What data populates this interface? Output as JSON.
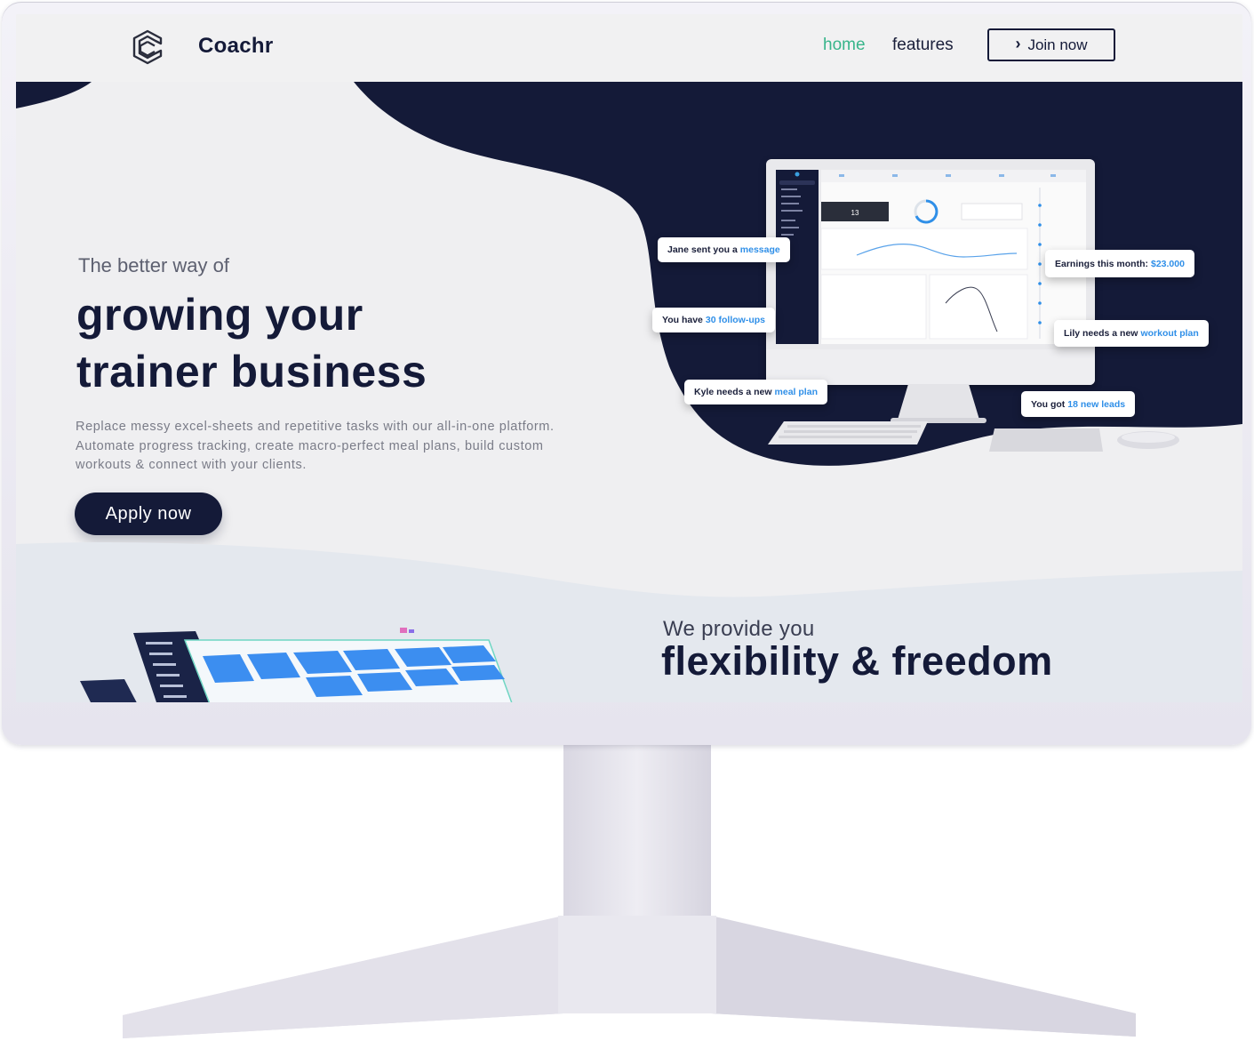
{
  "nav": {
    "brand": "Coachr",
    "links": [
      {
        "label": "home",
        "active": true
      },
      {
        "label": "features",
        "active": false
      }
    ],
    "cta_label": "Join now"
  },
  "hero": {
    "tagline": "The better way of",
    "headline_line1": "growing your",
    "headline_line2": "trainer business",
    "description_line1": "Replace messy excel-sheets and repetitive tasks with our all-in-one platform.",
    "description_line2": "Automate progress tracking, create macro-perfect meal plans, build custom",
    "description_line3": "workouts & connect with your clients.",
    "apply_label": "Apply now"
  },
  "notifications": [
    {
      "prefix": "Jane sent you a",
      "highlight": "message"
    },
    {
      "prefix": "You have",
      "highlight": "30 follow-ups"
    },
    {
      "prefix": "Kyle needs a new",
      "highlight": "meal plan"
    },
    {
      "prefix": "Earnings this month:",
      "highlight": "$23.000"
    },
    {
      "prefix": "Lily needs a new",
      "highlight": "workout plan"
    },
    {
      "prefix": "You got",
      "highlight": "18 new leads"
    }
  ],
  "section2": {
    "subtitle": "We provide you",
    "title": "flexibility & freedom"
  },
  "colors": {
    "navy": "#141a38",
    "accent_green": "#38b58b",
    "highlight_blue": "#2f8fe8",
    "screen_bg": "#efeff1"
  },
  "icons": [
    "coachr-logo-icon",
    "chevron-right-icon"
  ]
}
